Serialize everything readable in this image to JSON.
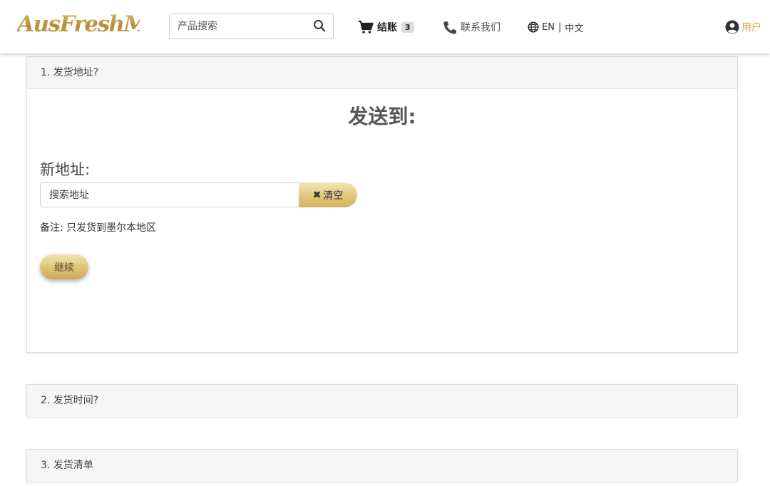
{
  "header": {
    "logo_text": "AusFreshMeat",
    "search": {
      "placeholder": "产品搜索",
      "value": ""
    },
    "checkout": {
      "label": "结账",
      "count": "3"
    },
    "contact": {
      "label": "联系我们"
    },
    "language": {
      "en": "EN",
      "separator": "|",
      "zh": "中文"
    },
    "user": {
      "label": "用户"
    }
  },
  "steps": [
    {
      "title": "1. 发货地址?"
    },
    {
      "title": "2. 发货时间?"
    },
    {
      "title": "3. 发货清单"
    }
  ],
  "address": {
    "ship_to_heading": "发送到:",
    "new_address_label": "新地址:",
    "search_placeholder": "搜索地址",
    "clear_label": "清空",
    "note": "备注: 只发货到墨尔本地区",
    "continue_label": "继续"
  },
  "colors": {
    "gold": "#d3a94a",
    "gold_light": "#f4e6b8",
    "panel_heading_bg": "#f6f6f6"
  },
  "icons": {
    "search": "search-icon",
    "cart": "cart-icon",
    "phone": "phone-icon",
    "globe": "globe-icon",
    "user": "user-circle-icon",
    "clear": "close-icon"
  }
}
